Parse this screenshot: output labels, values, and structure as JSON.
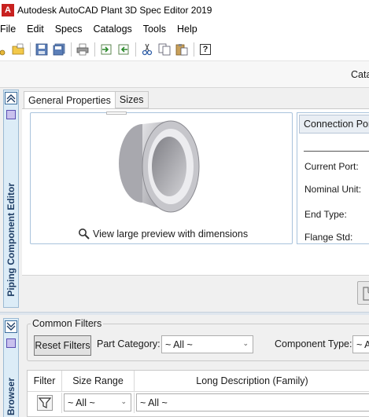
{
  "window": {
    "title": "Autodesk AutoCAD Plant 3D Spec Editor 2019",
    "app_icon_letter": "A"
  },
  "menu": [
    "File",
    "Edit",
    "Specs",
    "Catalogs",
    "Tools",
    "Help"
  ],
  "toolbar": {
    "icons": [
      "new-spec-icon",
      "open-icon",
      "save-icon",
      "save-all-icon",
      "print-icon",
      "import-icon",
      "export-icon",
      "cut-icon",
      "copy-icon",
      "paste-icon",
      "help-icon"
    ],
    "help_glyph": "?"
  },
  "catalog_header": {
    "label": "Cata"
  },
  "editor": {
    "panel_label": "Piping Component Editor",
    "tabs": [
      "General Properties",
      "Sizes"
    ],
    "preview_link": "View large preview with dimensions",
    "port_tab": "Connection Port",
    "port_labels": [
      "Current Port:",
      "Nominal Unit:",
      "End Type:",
      "Flange Std:"
    ]
  },
  "browser": {
    "panel_label": "Browser",
    "common_filters": "Common Filters",
    "reset_filters": "Reset Filters",
    "part_category_label": "Part Category:",
    "part_category_value": "~ All ~",
    "component_type_label": "Component Type:",
    "component_type_value": "~ A",
    "columns": {
      "filter": "Filter",
      "size_range": "Size Range",
      "long_description": "Long Description (Family)"
    },
    "size_range_value": "~ All ~",
    "long_desc_value": "~ All ~"
  },
  "colors": {
    "accent": "#3b6e9e",
    "panel_strip": "#dcecf7",
    "logo_red": "#c8211f"
  }
}
